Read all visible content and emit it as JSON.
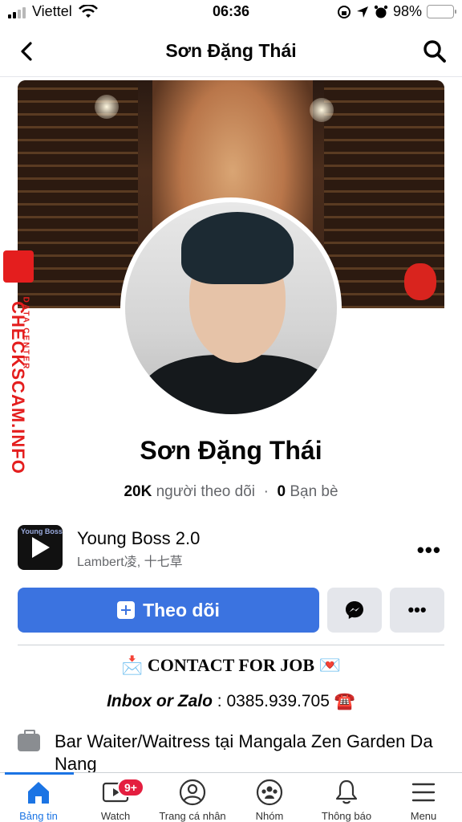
{
  "status_bar": {
    "carrier": "Viettel",
    "time": "06:36",
    "battery": "98%",
    "battery_level": 0.98
  },
  "header": {
    "title": "Sơn Đặng Thái"
  },
  "watermark": {
    "brand": "CHECKSCAM.INFO",
    "sub": "DATA CENTER"
  },
  "profile": {
    "name": "Sơn Đặng Thái",
    "followers_count": "20K",
    "followers_label": "người theo dõi",
    "friends_count": "0",
    "friends_label": "Bạn bè"
  },
  "music": {
    "cover_text": "Young Boss",
    "song": "Young Boss 2.0",
    "artist": "Lambert凌, 十七草",
    "more": "•••"
  },
  "actions": {
    "follow_label": "Theo dõi",
    "more": "•••"
  },
  "bio": {
    "line1": "📩 CONTACT FOR JOB 💌",
    "line2_emphasis": "Inbox or Zalo",
    "line2_rest": " : 0385.939.705 ☎️"
  },
  "work": {
    "text": "Bar Waiter/Waitress tại Mangala Zen Garden Da Nang"
  },
  "tabbar": {
    "items": [
      {
        "label": "Bảng tin",
        "icon": "home-icon",
        "active": true
      },
      {
        "label": "Watch",
        "icon": "watch-icon",
        "badge": "9+"
      },
      {
        "label": "Trang cá nhân",
        "icon": "profile-icon"
      },
      {
        "label": "Nhóm",
        "icon": "groups-icon"
      },
      {
        "label": "Thông báo",
        "icon": "bell-icon"
      },
      {
        "label": "Menu",
        "icon": "menu-icon"
      }
    ]
  },
  "colors": {
    "accent": "#1b74e4",
    "follow_button": "#3b73e0",
    "badge": "#e41e3f",
    "watermark": "#e41e1e"
  }
}
